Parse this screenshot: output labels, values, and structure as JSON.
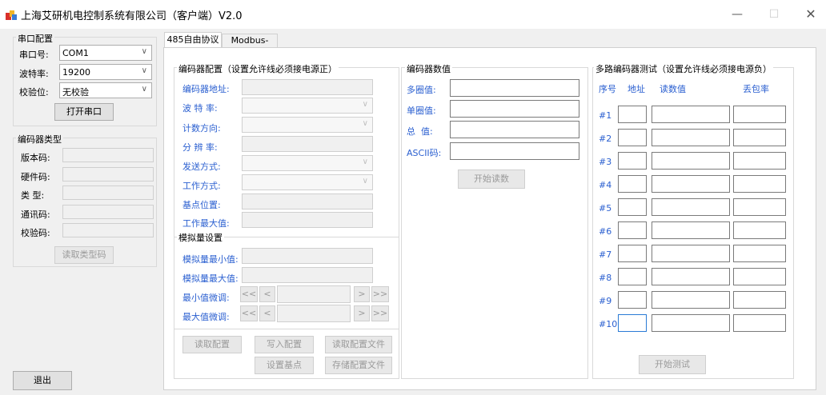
{
  "window": {
    "title": "上海艾研机电控制系统有限公司（客户端）V2.0"
  },
  "serial": {
    "group_label": "串口配置",
    "port_label": "串口号:",
    "port_value": "COM1",
    "baud_label": "波特率:",
    "baud_value": "19200",
    "parity_label": "校验位:",
    "parity_value": "无校验",
    "open_button": "打开串口"
  },
  "encoder_type": {
    "group_label": "编码器类型",
    "version_label": "版本码:",
    "hardware_label": "硬件码:",
    "type_label": "类 型:",
    "comm_label": "通讯码:",
    "checksum_label": "校验码:",
    "read_button": "读取类型码"
  },
  "exit_button": "退出",
  "tabs": [
    {
      "label": "485自由协议"
    },
    {
      "label": "Modbus-RTU"
    }
  ],
  "config": {
    "group_label": "编码器配置（设置允许线必须接电源正）",
    "address_label": "编码器地址:",
    "baud_label": "波 特 率:",
    "count_dir_label": "计数方向:",
    "resolution_label": "分 辨 率:",
    "send_mode_label": "发送方式:",
    "work_mode_label": "工作方式:",
    "base_pos_label": "基点位置:",
    "work_max_label": "工作最大值:"
  },
  "analog": {
    "group_label": "模拟量设置",
    "min_label": "模拟量最小值:",
    "max_label": "模拟量最大值:",
    "min_tune_label": "最小值微调:",
    "max_tune_label": "最大值微调:",
    "btn_ff_back": "<<",
    "btn_back": "<",
    "btn_fwd": ">",
    "btn_ff_fwd": ">>"
  },
  "config_buttons": {
    "read": "读取配置",
    "write": "写入配置",
    "read_file": "读取配置文件",
    "set_base": "设置基点",
    "save_file": "存储配置文件"
  },
  "values": {
    "group_label": "编码器数值",
    "multi_label": "多圈值:",
    "single_label": "单圈值:",
    "total_label": "总  值:",
    "ascii_label": "ASCII码:",
    "start_read": "开始读数"
  },
  "multi_test": {
    "group_label": "多路编码器测试（设置允许线必须接电源负）",
    "col_seq": "序号",
    "col_addr": "地址",
    "col_read": "读数值",
    "col_loss": "丢包率",
    "rows": [
      "#1",
      "#2",
      "#3",
      "#4",
      "#5",
      "#6",
      "#7",
      "#8",
      "#9",
      "#10"
    ],
    "start_test": "开始测试"
  },
  "icons": {
    "app": "app-icon",
    "minimize": "minimize-icon",
    "maximize": "maximize-icon",
    "close": "close-icon",
    "dropdown": "chevron-down-icon"
  }
}
